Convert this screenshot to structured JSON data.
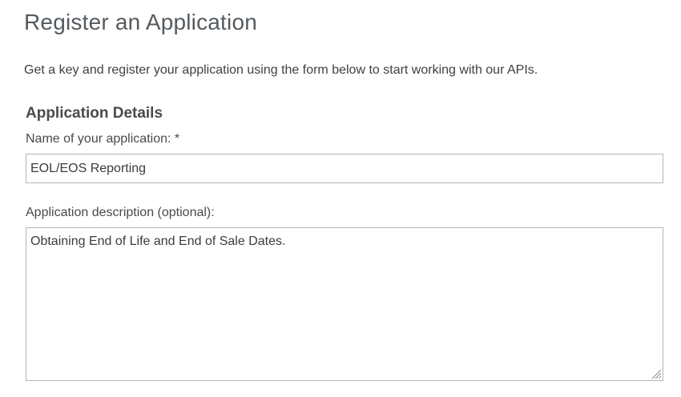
{
  "page": {
    "title": "Register an Application",
    "intro": "Get a key and register your application using the form below to start working with our APIs."
  },
  "details": {
    "section_title": "Application Details",
    "name_label": "Name of your application: *",
    "name_value": "EOL/EOS Reporting",
    "description_label": "Application description (optional):",
    "description_value": "Obtaining End of Life and End of Sale Dates."
  },
  "icons": {
    "resize_handle": "resize-grip-icon"
  }
}
